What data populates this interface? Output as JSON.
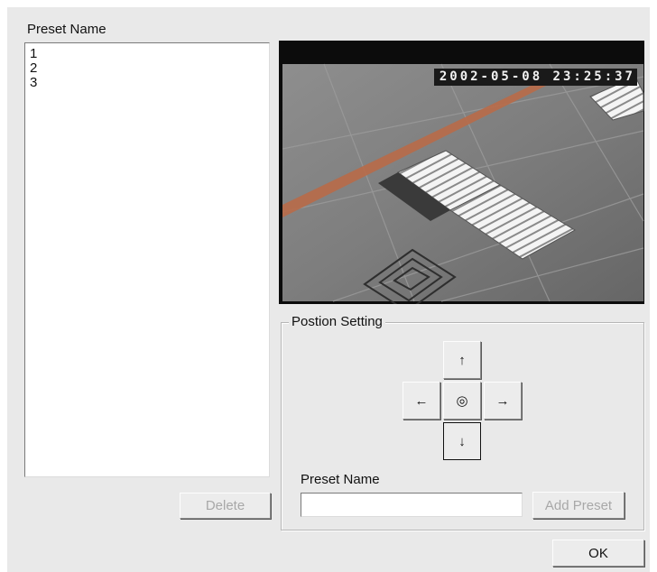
{
  "dialog": {
    "preset_list_label": "Preset Name",
    "presets": [
      "1",
      "2",
      "3"
    ],
    "delete_label": "Delete",
    "ok_label": "OK"
  },
  "video": {
    "timestamp": "2002-05-08 23:25:37"
  },
  "position_setting": {
    "title": "Postion Setting",
    "up_glyph": "↑",
    "down_glyph": "↓",
    "left_glyph": "←",
    "right_glyph": "→",
    "center_glyph": "◎",
    "preset_name_label": "Preset Name",
    "preset_name_value": "",
    "preset_name_placeholder": "",
    "add_preset_label": "Add Preset"
  },
  "colors": {
    "dialog_bg": "#e9e9e9",
    "disabled_text": "#a8a8a8"
  }
}
